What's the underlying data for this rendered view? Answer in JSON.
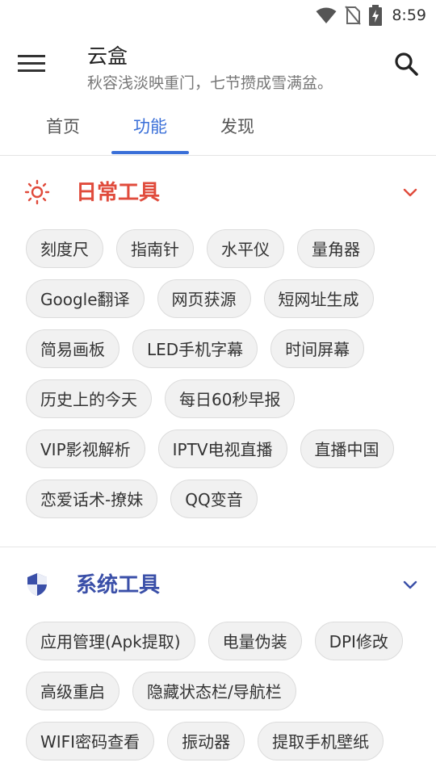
{
  "status_bar": {
    "time": "8:59",
    "icons": [
      "wifi-icon",
      "no-sim-icon",
      "battery-charging-icon"
    ]
  },
  "app_bar": {
    "title": "云盒",
    "subtitle": "秋容浅淡映重门，七节攒成雪满盆。",
    "menu_icon": "menu-icon",
    "search_icon": "search-icon"
  },
  "tabs": [
    {
      "label": "首页",
      "active": false
    },
    {
      "label": "功能",
      "active": true
    },
    {
      "label": "发现",
      "active": false
    }
  ],
  "colors": {
    "accent": "#3a6fd8",
    "daily_section": "#e04b3c",
    "system_section": "#3a4fa8"
  },
  "sections": [
    {
      "title": "日常工具",
      "icon": "sun-icon",
      "items": [
        "刻度尺",
        "指南针",
        "水平仪",
        "量角器",
        "Google翻译",
        "网页获源",
        "短网址生成",
        "简易画板",
        "LED手机字幕",
        "时间屏幕",
        "历史上的今天",
        "每日60秒早报",
        "VIP影视解析",
        "IPTV电视直播",
        "直播中国",
        "恋爱话术-撩妹",
        "QQ变音"
      ]
    },
    {
      "title": "系统工具",
      "icon": "shield-icon",
      "items": [
        "应用管理(Apk提取)",
        "电量伪装",
        "DPI修改",
        "高级重启",
        "隐藏状态栏/导航栏",
        "WIFI密码查看",
        "振动器",
        "提取手机壁纸"
      ]
    }
  ]
}
